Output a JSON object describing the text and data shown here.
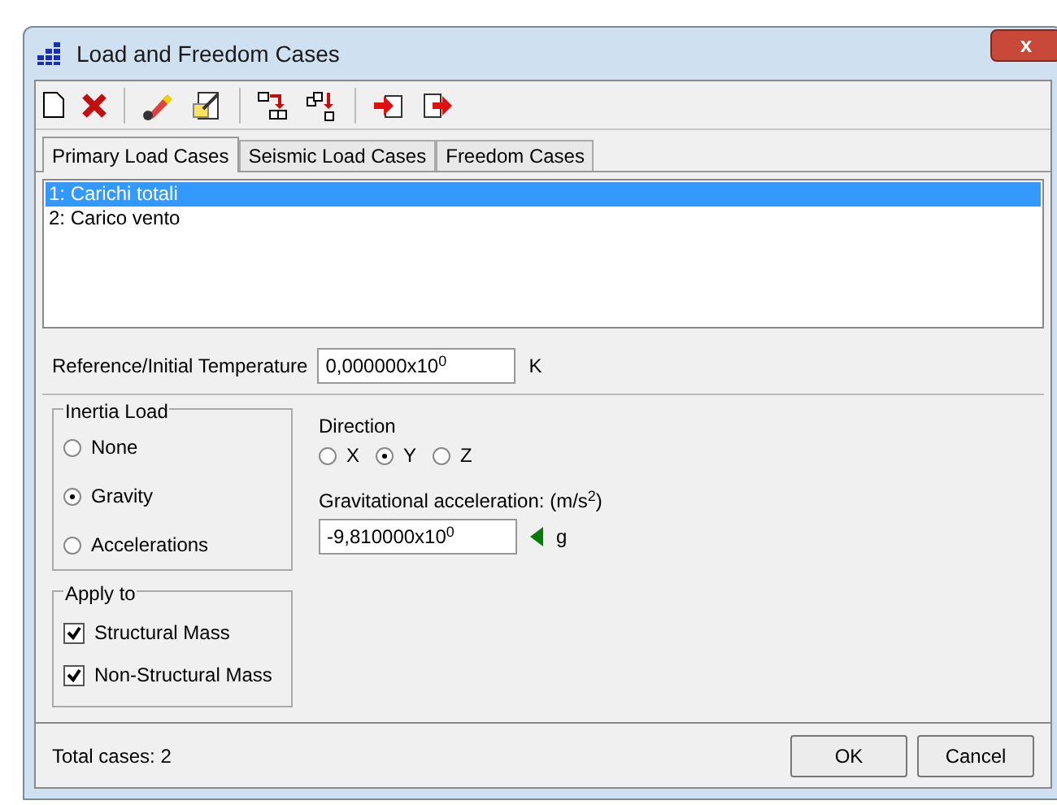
{
  "window": {
    "title": "Load and Freedom Cases",
    "close": "x"
  },
  "tabs": [
    {
      "label": "Primary Load Cases",
      "selected": true
    },
    {
      "label": "Seismic Load Cases",
      "selected": false
    },
    {
      "label": "Freedom Cases",
      "selected": false
    }
  ],
  "cases": [
    {
      "label": "1: Carichi totali",
      "selected": true
    },
    {
      "label": "2: Carico vento",
      "selected": false
    }
  ],
  "temperature": {
    "label": "Reference/Initial Temperature",
    "value": "0,000000x10$^{0}$",
    "unit": "K"
  },
  "inertia_load": {
    "title": "Inertia Load",
    "options": [
      {
        "label": "None",
        "selected": false
      },
      {
        "label": "Gravity",
        "selected": true
      },
      {
        "label": "Accelerations",
        "selected": false
      }
    ]
  },
  "direction": {
    "label": "Direction",
    "options": [
      {
        "label": "X",
        "selected": false
      },
      {
        "label": "Y",
        "selected": true
      },
      {
        "label": "Z",
        "selected": false
      }
    ]
  },
  "gravity": {
    "label": "Gravitational acceleration: (m/s$^{2}$)",
    "value": "-9,810000x10$^{0}$",
    "unit": "g"
  },
  "apply_to": {
    "title": "Apply to",
    "options": [
      {
        "label": "Structural Mass",
        "checked": true
      },
      {
        "label": "Non-Structural Mass",
        "checked": true
      }
    ]
  },
  "status": "Total cases: 2",
  "buttons": [
    "OK",
    "Cancel"
  ]
}
